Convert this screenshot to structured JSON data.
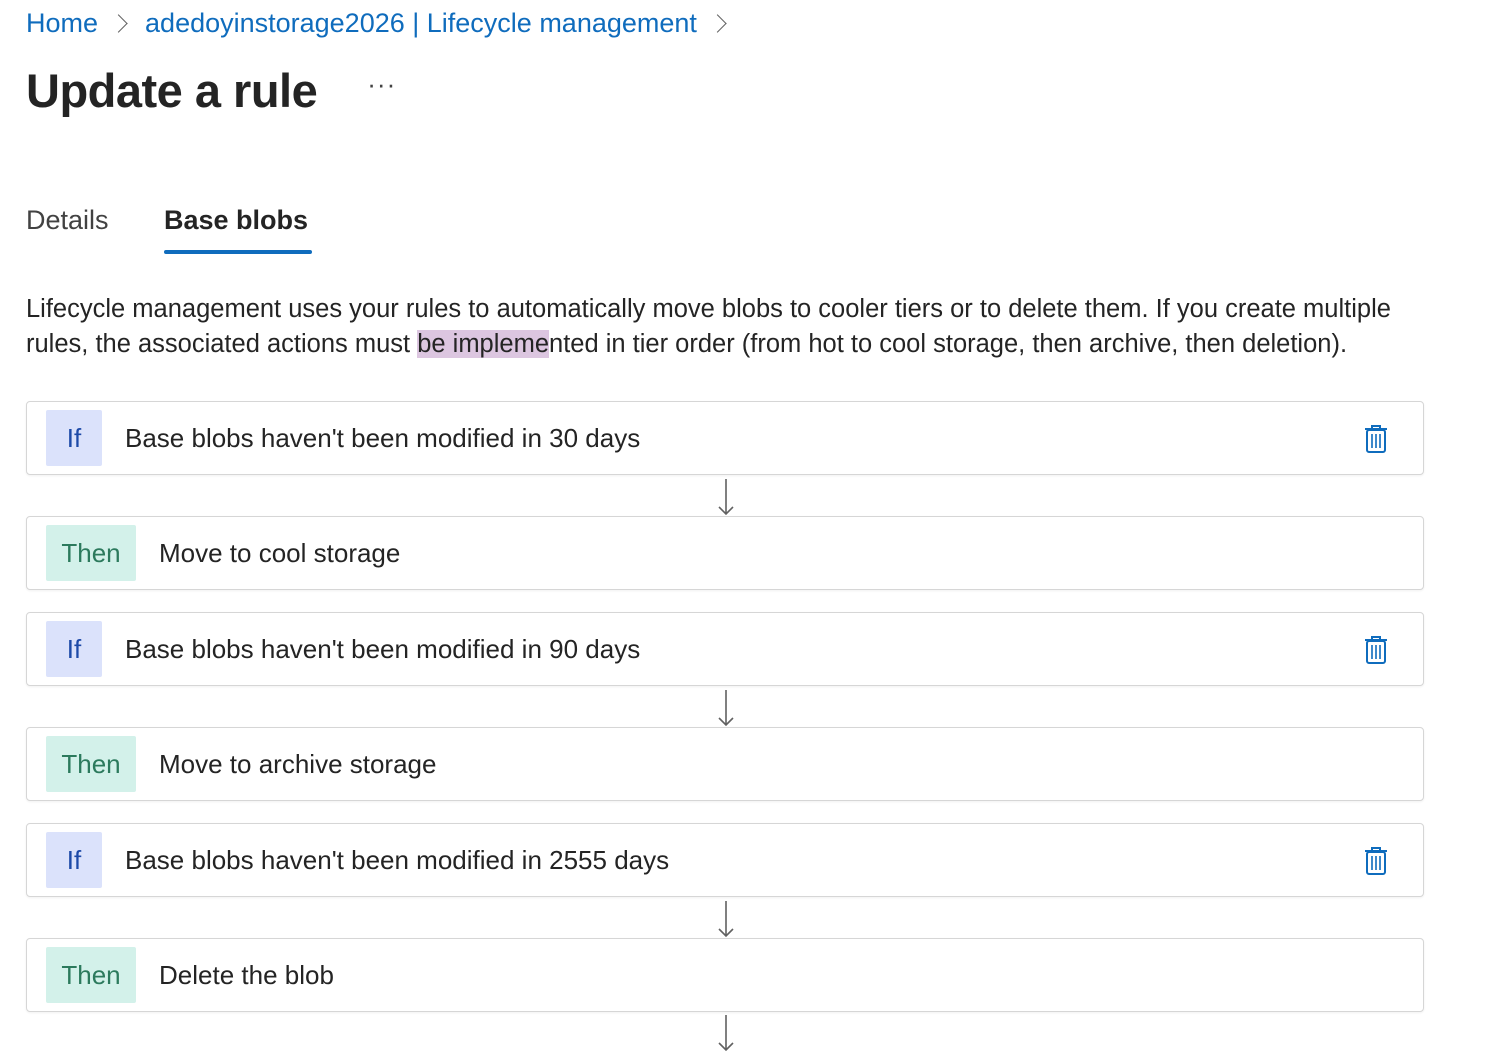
{
  "breadcrumb": {
    "home": "Home",
    "resource": "adedoyinstorage2026 | Lifecycle management"
  },
  "page": {
    "title": "Update a rule",
    "more": "···"
  },
  "tabs": {
    "details": "Details",
    "base_blobs": "Base blobs",
    "active": "Base blobs"
  },
  "description": {
    "part1": "Lifecycle management uses your rules to automatically move blobs to cooler tiers or to delete them. If you create multiple rules, the associated actions must ",
    "highlight": "be impleme",
    "part2": "nted in tier order (from hot to cool storage, then archive, then deletion)."
  },
  "rules": [
    {
      "if_label": "If",
      "condition": "Base blobs haven't been modified in 30 days",
      "then_label": "Then",
      "action": "Move to cool storage"
    },
    {
      "if_label": "If",
      "condition": "Base blobs haven't been modified in 90 days",
      "then_label": "Then",
      "action": "Move to archive storage"
    },
    {
      "if_label": "If",
      "condition": "Base blobs haven't been modified in 2555 days",
      "then_label": "Then",
      "action": "Delete the blob"
    }
  ],
  "icons": {
    "delete": "trash-icon",
    "arrow": "arrow-down-icon",
    "breadcrumb_separator": "chevron-right-icon"
  },
  "colors": {
    "link": "#0f6cbd",
    "if_badge_bg": "#dbe2fb",
    "if_badge_text": "#1d4aa8",
    "then_badge_bg": "#d3f1ea",
    "then_badge_text": "#2c7a5d",
    "highlight": "#dcc6e0"
  }
}
